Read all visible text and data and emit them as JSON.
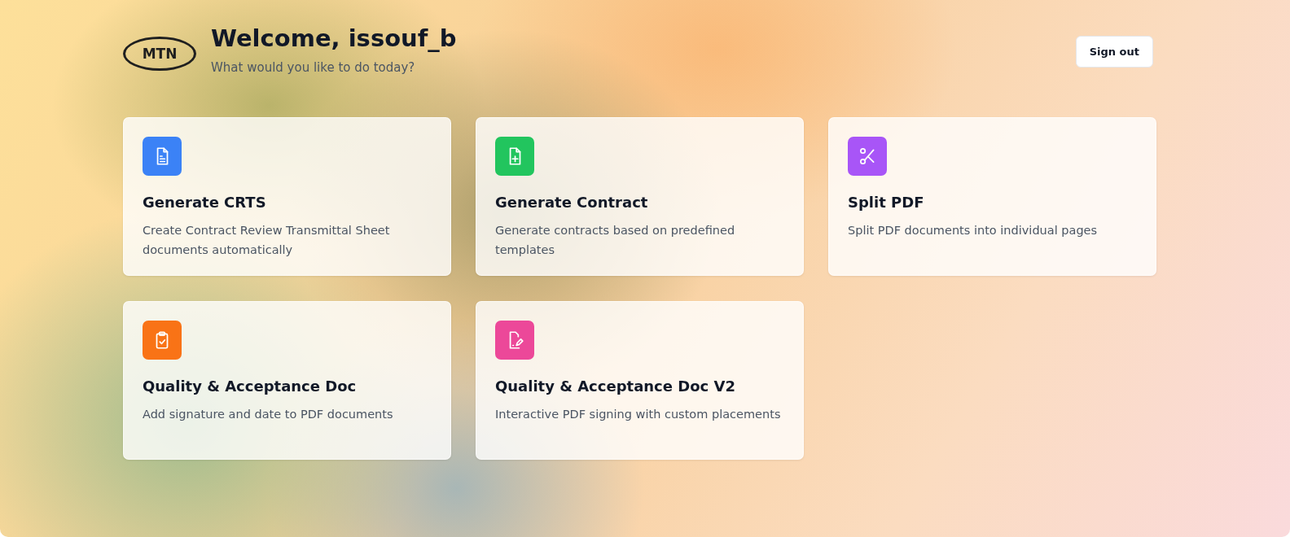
{
  "header": {
    "logo": "MTN",
    "title": "Welcome, issouf_b",
    "subtitle": "What would you like to do today?",
    "sign_out": "Sign out"
  },
  "cards": [
    {
      "kind": "document",
      "color": "#3b82f6",
      "title": "Generate CRTS",
      "description": "Create Contract Review Transmittal Sheet documents automatically"
    },
    {
      "kind": "document-plus",
      "color": "#22c55e",
      "title": "Generate Contract",
      "description": "Generate contracts based on predefined templates"
    },
    {
      "kind": "scissors",
      "color": "#a855f7",
      "title": "Split PDF",
      "description": "Split PDF documents into individual pages"
    },
    {
      "kind": "clipboard-check",
      "color": "#f97316",
      "title": "Quality & Acceptance Doc",
      "description": "Add signature and date to PDF documents"
    },
    {
      "kind": "document-pen",
      "color": "#ec4899",
      "title": "Quality & Acceptance Doc V2",
      "description": "Interactive PDF signing with custom placements"
    }
  ]
}
